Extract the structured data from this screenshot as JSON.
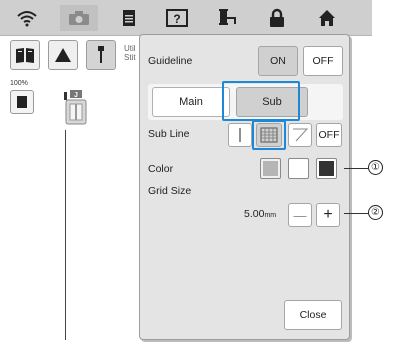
{
  "sidebar": {
    "truncated_label_line1": "Util",
    "truncated_label_line2": "Stit"
  },
  "zoom_level": "100%",
  "top_icons": [
    "wifi-icon",
    "camera-icon",
    "document-icon",
    "help-icon",
    "thread-spool-icon",
    "lock-icon",
    "home-icon"
  ],
  "dialog": {
    "guideline_label": "Guideline",
    "guideline_on": "ON",
    "guideline_off": "OFF",
    "tab_main": "Main",
    "tab_sub": "Sub",
    "subline_label": "Sub Line",
    "subline_off": "OFF",
    "color_label": "Color",
    "gridsize_label": "Grid Size",
    "gridsize_value": "5.00",
    "gridsize_unit": "mm",
    "minus_label": "—",
    "plus_label": "+",
    "close_label": "Close"
  },
  "callouts": {
    "c1": "①",
    "c2": "②"
  },
  "colors": {
    "highlight": "#1e88d8",
    "color_swatch_gray": "#b5b5b5",
    "color_swatch_black": "#333333"
  }
}
